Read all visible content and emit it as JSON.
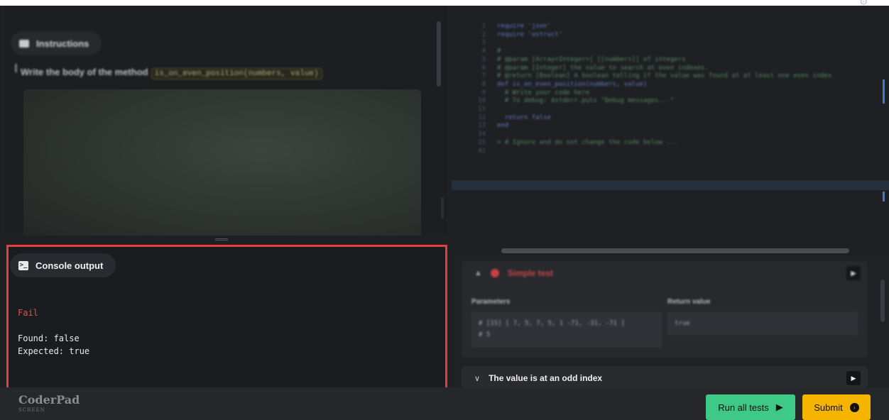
{
  "instructions": {
    "title": "Instructions",
    "text": "Write the body of the method",
    "method_signature": "is_on_even_position(numbers, value)"
  },
  "console": {
    "title": "Console output",
    "fail_line": "Fail",
    "found_line": "Found: false",
    "expected_line": "Expected: true"
  },
  "editor": {
    "lines": [
      {
        "n": "1",
        "text": "require 'json'"
      },
      {
        "n": "2",
        "text": "require 'ostruct'"
      },
      {
        "n": "3",
        "text": ""
      },
      {
        "n": "4",
        "text": "#"
      },
      {
        "n": "5",
        "text": "# @param [Array<Integer>] [[numbers]] of integers"
      },
      {
        "n": "6",
        "text": "# @param [Integer] the value to search at even indexes."
      },
      {
        "n": "7",
        "text": "# @return [Boolean] A boolean telling if the value was found at at least one even index"
      },
      {
        "n": "8",
        "text": "def is_on_even_position(numbers, value)"
      },
      {
        "n": "9",
        "text": "  # Write your code here"
      },
      {
        "n": "10",
        "text": "  # To debug: $stderr.puts \"Debug messages...\""
      },
      {
        "n": "11",
        "text": ""
      },
      {
        "n": "12",
        "text": "  return false"
      },
      {
        "n": "13",
        "text": "end"
      },
      {
        "n": "14",
        "text": ""
      },
      {
        "n": "15",
        "text": "> # Ignore and do not change the code below ..."
      },
      {
        "n": "41",
        "text": ""
      }
    ]
  },
  "tests": {
    "test1": {
      "name": "Simple test",
      "params_label": "Parameters",
      "return_label": "Return value",
      "params_value_1": "# [15] [ 7,  5,  7,  5,  1  -71,  -31,  -71 ]",
      "params_value_2": "# 5",
      "return_value": "true"
    },
    "test2": {
      "name": "The value is at an odd index"
    }
  },
  "footer": {
    "brand": "CoderPad",
    "brand_sub": "SCREEN",
    "run_all_label": "Run all tests",
    "submit_label": "Submit"
  },
  "colors": {
    "fail": "#e05252",
    "highlight_border": "#e53e3e",
    "run_button": "#3fc986",
    "submit_button": "#f4b400"
  },
  "icons": {
    "instructions": "document-icon",
    "console": "terminal-icon",
    "play": "play-icon",
    "chevron": "chevron-icon",
    "settings": "gear-icon"
  }
}
